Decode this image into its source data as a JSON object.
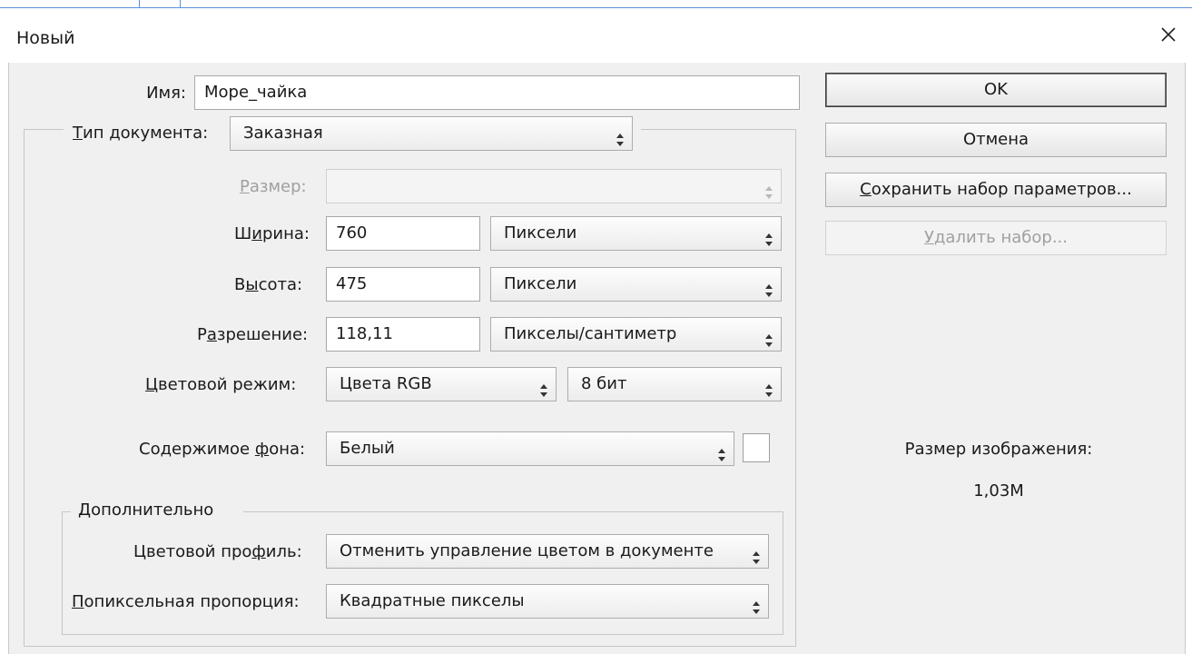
{
  "window": {
    "title": "Новый"
  },
  "name": {
    "label": "Имя:",
    "value": "Море_чайка"
  },
  "doc_type": {
    "label_u": "Т",
    "label_rest": "ип документа:",
    "value": "Заказная"
  },
  "size": {
    "label_u": "Р",
    "label_rest": "азмер:",
    "value": ""
  },
  "width": {
    "label_pre": "Ш",
    "label_u": "и",
    "label_rest": "рина:",
    "value": "760",
    "unit": "Пиксели"
  },
  "height": {
    "label_pre": "В",
    "label_u": "ы",
    "label_rest": "сота:",
    "value": "475",
    "unit": "Пиксели"
  },
  "resolution": {
    "label_pre": "Р",
    "label_u": "а",
    "label_rest": "зрешение:",
    "value": "118,11",
    "unit": "Пикселы/сантиметр"
  },
  "color_mode": {
    "label_u": "Ц",
    "label_rest": "ветовой режим:",
    "value": "Цвета RGB",
    "depth": "8 бит"
  },
  "background": {
    "label_pre": "Содержимое ",
    "label_u": "ф",
    "label_rest": "она:",
    "value": "Белый",
    "swatch_color": "#ffffff"
  },
  "advanced": {
    "title": "Дополнительно",
    "profile": {
      "label_pre": "Цветовой про",
      "label_u": "ф",
      "label_rest": "иль:",
      "value": "Отменить управление цветом в документе"
    },
    "aspect": {
      "label_u": "П",
      "label_rest": "опиксельная пропорция:",
      "value": "Квадратные пикселы"
    }
  },
  "buttons": {
    "ok": "OK",
    "cancel": "Отмена",
    "save_preset_u": "С",
    "save_preset_rest": "охранить набор параметров...",
    "delete_preset_u": "У",
    "delete_preset_rest": "далить набор..."
  },
  "image_size": {
    "label": "Размер изображения:",
    "value": "1,03M"
  },
  "colors": {
    "accent": "#5a93d6",
    "client_bg": "#f0f0f0",
    "disabled_text": "#a0a0a0"
  }
}
